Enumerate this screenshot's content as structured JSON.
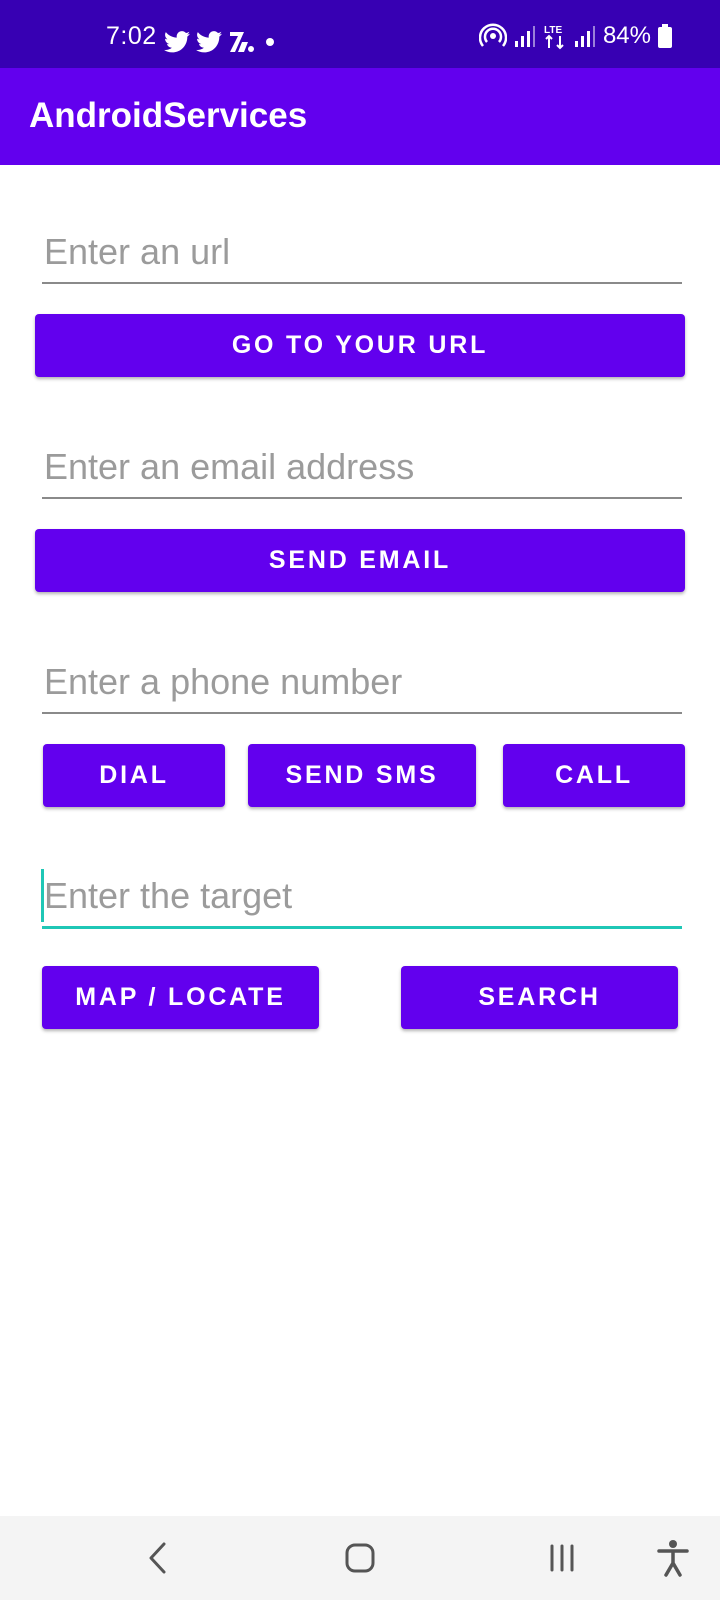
{
  "status_bar": {
    "time": "7:02",
    "battery": "84%",
    "left_icons": [
      "twitter-icon",
      "twitter-icon",
      "news-icon",
      "dot-icon"
    ],
    "right_icons": [
      "hotspot-icon",
      "signal-icon",
      "lte-icon",
      "signal-icon",
      "battery-icon"
    ]
  },
  "app_bar": {
    "title": "AndroidServices"
  },
  "form": {
    "url_placeholder": "Enter an url",
    "go_url_label": "GO TO YOUR URL",
    "email_placeholder": "Enter an email address",
    "send_email_label": "SEND EMAIL",
    "phone_placeholder": "Enter a phone number",
    "dial_label": "DIAL",
    "send_sms_label": "SEND SMS",
    "call_label": "CALL",
    "target_placeholder": "Enter the target",
    "map_label": "MAP / LOCATE",
    "search_label": "SEARCH"
  },
  "colors": {
    "status_bar": "#3700b3",
    "primary": "#6200ee",
    "accent": "#1fc7b6"
  },
  "nav_bar": {
    "icons": [
      "back-icon",
      "home-icon",
      "recents-icon",
      "accessibility-icon"
    ]
  }
}
